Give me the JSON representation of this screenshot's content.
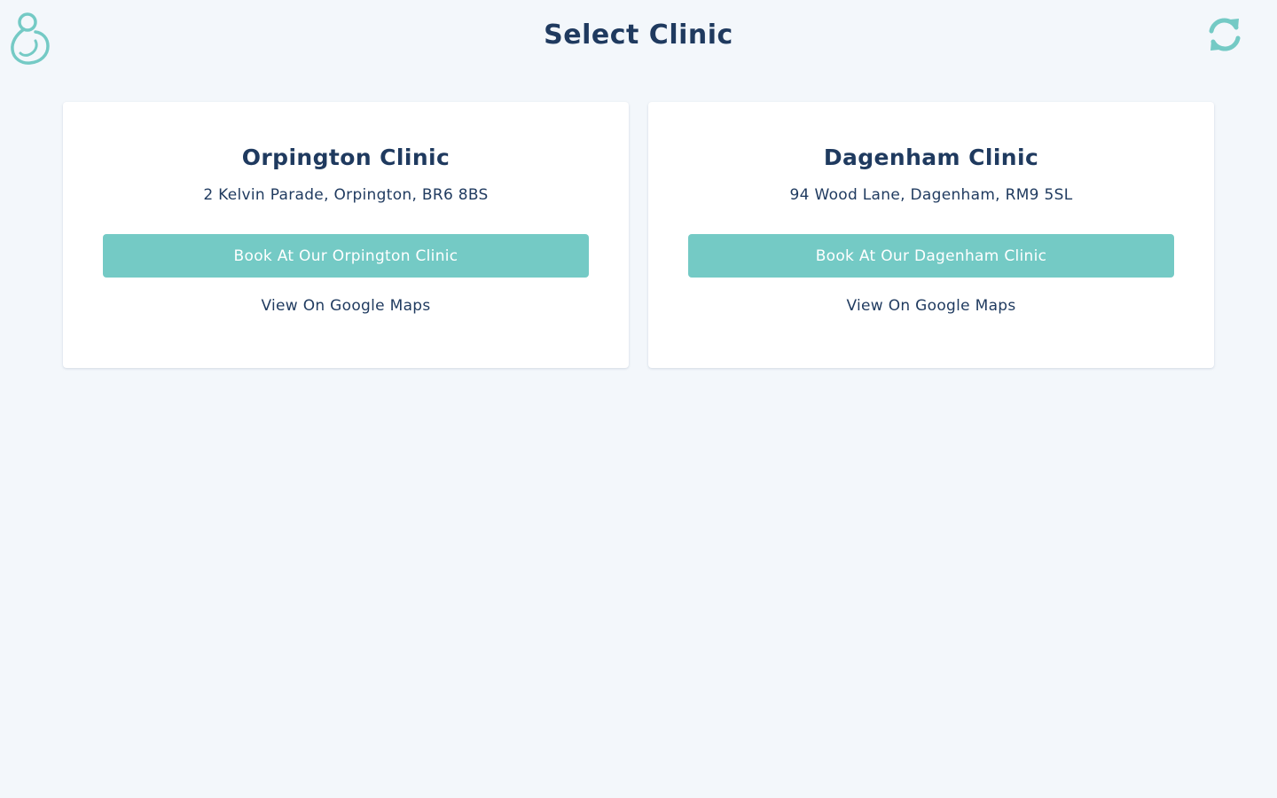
{
  "header": {
    "title": "Select Clinic",
    "logo_icon": "mother-baby-logo-icon",
    "refresh_icon": "refresh-icon"
  },
  "colors": {
    "accent": "#74cac5",
    "text": "#1f3a5f",
    "background": "#f3f7fb",
    "card": "#ffffff"
  },
  "clinics": [
    {
      "name": "Orpington Clinic",
      "address": "2 Kelvin Parade, Orpington, BR6 8BS",
      "book_label": "Book At Our Orpington Clinic",
      "maps_label": "View On Google Maps"
    },
    {
      "name": "Dagenham Clinic",
      "address": "94 Wood Lane, Dagenham, RM9 5SL",
      "book_label": "Book At Our Dagenham Clinic",
      "maps_label": "View On Google Maps"
    }
  ]
}
